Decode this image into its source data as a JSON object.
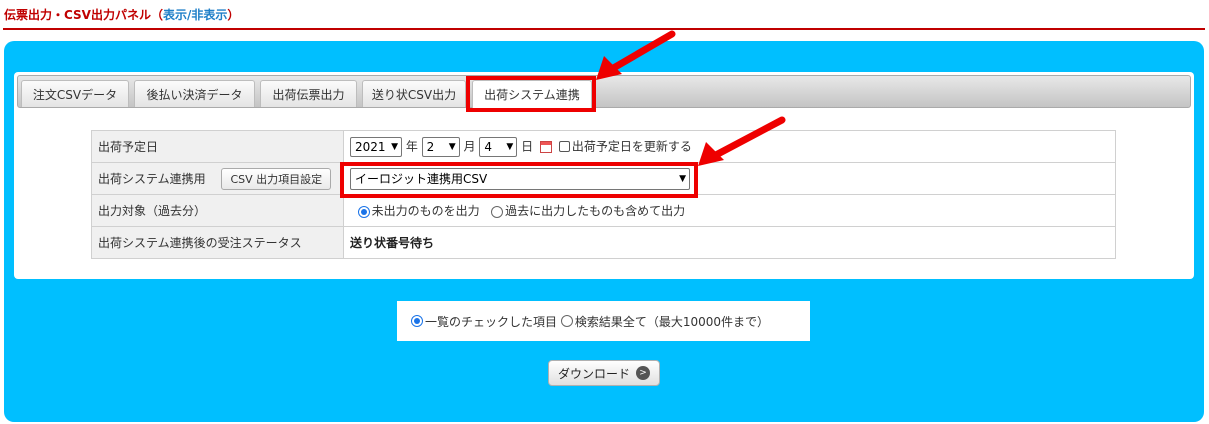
{
  "panel": {
    "title": "伝票出力・CSV出力パネル（",
    "toggle": "表示/非表示",
    "title_close": "）"
  },
  "tabs": [
    {
      "label": "注文CSVデータ"
    },
    {
      "label": "後払い決済データ"
    },
    {
      "label": "出荷伝票出力"
    },
    {
      "label": "送り状CSV出力"
    },
    {
      "label": "出荷システム連携",
      "active": true
    }
  ],
  "form": {
    "ship_date": {
      "label": "出荷予定日",
      "year": "2021",
      "year_unit": "年",
      "month": "2",
      "month_unit": "月",
      "day": "4",
      "day_unit": "日",
      "update_label": "出荷予定日を更新する"
    },
    "integration": {
      "label": "出荷システム連携用",
      "settings_button": "CSV 出力項目設定",
      "selected": "イーロジット連携用CSV"
    },
    "target": {
      "label": "出力対象（過去分）",
      "options": [
        "未出力のものを出力",
        "過去に出力したものも含めて出力"
      ]
    },
    "status": {
      "label": "出荷システム連携後の受注ステータス",
      "value": "送り状番号待ち"
    }
  },
  "export_scope": {
    "options": [
      "一覧のチェックした項目",
      "検索結果全て（最大10000件まで）"
    ]
  },
  "download": {
    "label": "ダウンロード"
  },
  "colors": {
    "accent_blue": "#00bfff",
    "header_red": "#c00000",
    "highlight_red": "#ee0000"
  }
}
